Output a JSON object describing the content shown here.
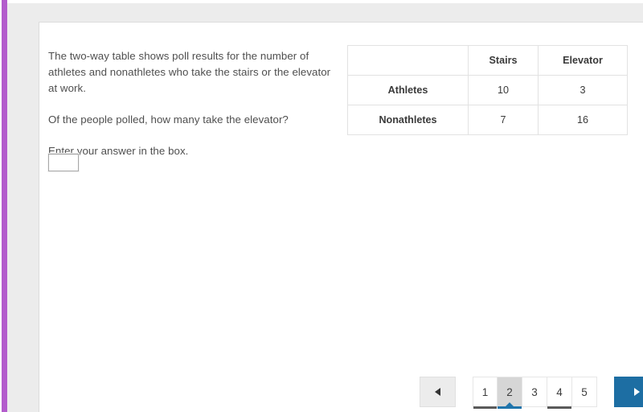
{
  "theme": {
    "accent_bar_color": "#b35ccc",
    "page_background": "#ececec",
    "card_background": "#ffffff",
    "primary_button_color": "#1d6ea3",
    "active_page_background": "#d6d6d6",
    "current_underline_color": "#1f74ab",
    "visited_underline_color": "#5a5a5a",
    "text_color": "#4f4f4f"
  },
  "question": {
    "paragraphs": [
      "The two-way table shows poll results for the number of athletes and nonathletes who take the stairs or the elevator at work.",
      "Of the people polled, how many take the elevator?",
      "Enter your answer in the box."
    ]
  },
  "answer": {
    "value": "",
    "placeholder": ""
  },
  "table": {
    "corner_label": "",
    "column_headers": [
      "Stairs",
      "Elevator"
    ],
    "rows": [
      {
        "label": "Athletes",
        "values": [
          "10",
          "3"
        ]
      },
      {
        "label": "Nonathletes",
        "values": [
          "7",
          "16"
        ]
      }
    ]
  },
  "pagination": {
    "prev_label": "◄",
    "next_label": "►",
    "pages": [
      {
        "label": "1",
        "state": "visited"
      },
      {
        "label": "2",
        "state": "current"
      },
      {
        "label": "3",
        "state": "unvisited"
      },
      {
        "label": "4",
        "state": "visited"
      },
      {
        "label": "5",
        "state": "unvisited"
      }
    ]
  }
}
